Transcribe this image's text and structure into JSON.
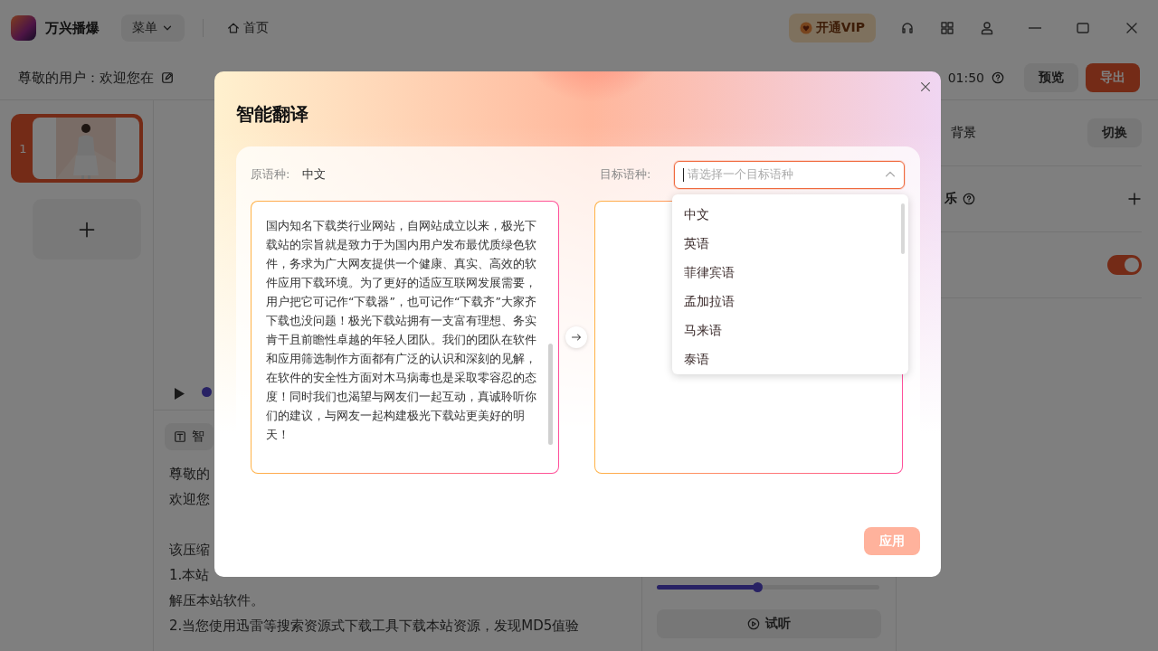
{
  "app": {
    "name": "万兴播爆",
    "menu": "菜单",
    "home": "首页",
    "vip": "开通VIP"
  },
  "toolbar": {
    "greeting": "尊敬的用户：欢迎您在",
    "duration": "01:50",
    "preview": "预览",
    "export": "导出"
  },
  "scenes": [
    {
      "number": "1",
      "selected": true
    }
  ],
  "script": {
    "tab": "智",
    "lines": [
      "尊敬的",
      "欢迎您"
    ],
    "notes": [
      "该压缩",
      "1.本站",
      "解压本站软件。",
      "2.当您使用迅雷等搜索资源式下载工具下载本站资源，发现MD5值验"
    ]
  },
  "voice": {
    "speed": {
      "level": 0.45
    },
    "listen": "试听"
  },
  "settings": {
    "background": "背景",
    "switch": "切换",
    "music": "乐",
    "toggle": {
      "on": true
    }
  },
  "dialog": {
    "title": "智能翻译",
    "source_label": "原语种:",
    "source_language": "中文",
    "target_label": "目标语种:",
    "target": {
      "placeholder": "请选择一个目标语种",
      "expanded": true
    },
    "source_text": "国内知名下载类行业网站，自网站成立以来，极光下载站的宗旨就是致力于为国内用户发布最优质绿色软件，务求为广大网友提供一个健康、真实、高效的软件应用下载环境。为了更好的适应互联网发展需要，用户把它可记作“下载器”，也可记作“下载齐”大家齐下载也没问题！极光下载站拥有一支富有理想、务实肯干且前瞻性卓越的年轻人团队。我们的团队在软件和应用筛选制作方面都有广泛的认识和深刻的见解，在软件的安全性方面对木马病毒也是采取零容忍的态度！同时我们也渴望与网友们一起互动，真诚聆听你们的建议，与网友一起构建极光下载站更美好的明天！",
    "languages": [
      {
        "label": "中文",
        "selected": false
      },
      {
        "label": "英语",
        "selected": false
      },
      {
        "label": "菲律宾语",
        "selected": false
      },
      {
        "label": "孟加拉语",
        "selected": false
      },
      {
        "label": "马来语",
        "selected": false
      },
      {
        "label": "泰语",
        "selected": false
      }
    ],
    "apply": {
      "label": "应用",
      "disabled": true
    }
  }
}
